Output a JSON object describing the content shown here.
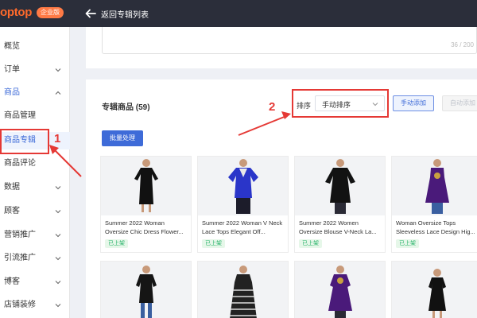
{
  "topbar": {
    "logo_text": "optop",
    "edition_badge": "企业版",
    "back_label": "返回专辑列表"
  },
  "sidebar": {
    "items": [
      {
        "label": "概览",
        "has_chevron": false
      },
      {
        "label": "订单",
        "has_chevron": true
      },
      {
        "label": "商品",
        "has_chevron": true,
        "expanded": true
      },
      {
        "label": "商品管理",
        "has_chevron": false
      },
      {
        "label": "商品专辑",
        "has_chevron": false,
        "active": true
      },
      {
        "label": "商品评论",
        "has_chevron": false
      },
      {
        "label": "数据",
        "has_chevron": true
      },
      {
        "label": "顾客",
        "has_chevron": true
      },
      {
        "label": "营销推广",
        "has_chevron": true
      },
      {
        "label": "引流推广",
        "has_chevron": true
      },
      {
        "label": "博客",
        "has_chevron": true
      },
      {
        "label": "店铺装修",
        "has_chevron": true
      }
    ]
  },
  "description": {
    "counter": "36 / 200"
  },
  "album": {
    "title": "专辑商品 (59)",
    "sort_label": "排序",
    "sort_value": "手动排序",
    "manual_add_label": "手动添加",
    "auto_add_label": "自动添加",
    "batch_label": "批量处理"
  },
  "products": [
    {
      "title": "Summer 2022 Woman Oversize Chic Dress Flower...",
      "status": "已上架"
    },
    {
      "title": "Summer 2022 Woman V Neck Lace Tops Elegant Off...",
      "status": "已上架"
    },
    {
      "title": "Summer 2022 Women Oversize Blouse V-Neck La...",
      "status": "已上架"
    },
    {
      "title": "Woman Oversize Tops Sleeveless Lace Design Hig...",
      "status": "已上架"
    }
  ],
  "annotations": {
    "step1": "1",
    "step2": "2"
  },
  "colors": {
    "accent": "#3e6bd8",
    "highlight": "#e53935",
    "topbar": "#2b2e3a",
    "brand": "#ff6a2b"
  }
}
